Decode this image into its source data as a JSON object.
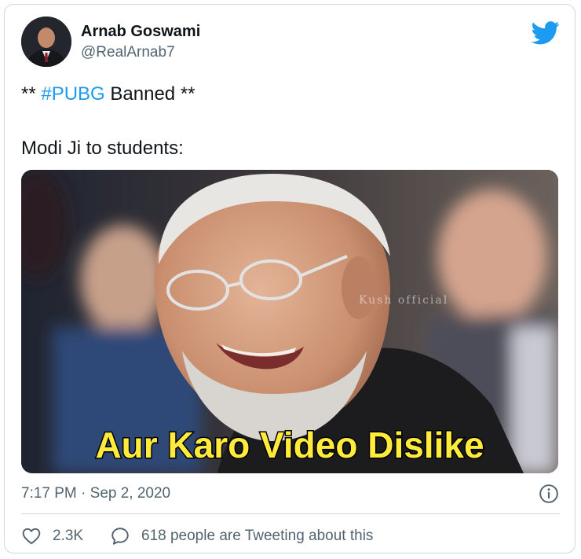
{
  "author": {
    "name": "Arnab Goswami",
    "handle": "@RealArnab7"
  },
  "tweet": {
    "line1_prefix": "** ",
    "hashtag": "#PUBG",
    "line1_suffix": " Banned **",
    "line2": "Modi Ji to students:"
  },
  "media": {
    "caption": "Aur Karo Video Dislike",
    "watermark": "Kush official"
  },
  "meta": {
    "timestamp": "7:17 PM · Sep 2, 2020"
  },
  "actions": {
    "likes": "2.3K",
    "conversation": "618 people are Tweeting about this"
  },
  "colors": {
    "accent": "#1d9bf0",
    "secondary_text": "#536471",
    "caption_fill": "#ffeb3b"
  },
  "icons": {
    "brand": "twitter-bird-icon",
    "info": "info-icon",
    "like": "heart-icon",
    "reply": "speech-bubble-icon"
  }
}
